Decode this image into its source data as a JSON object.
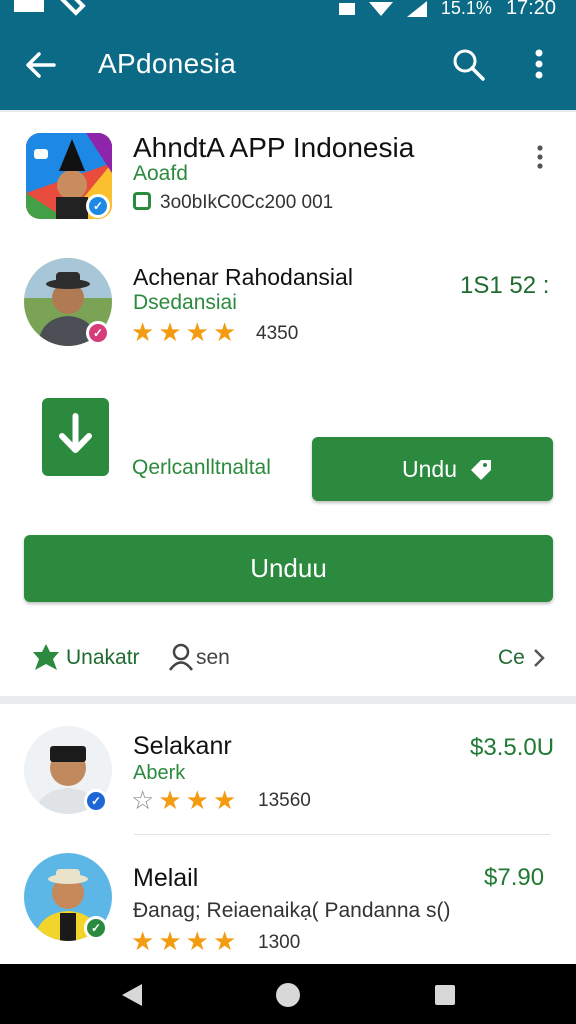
{
  "appbar": {
    "title": "APdonesia"
  },
  "app_header": {
    "name": "AhndtA APP Indonesia",
    "subtitle": "Aoafd",
    "code": "3o0bIkC0Cc200 001"
  },
  "reviewer": {
    "name": "Achenar Rahodansial",
    "subtitle": "Dsedansiai",
    "rating_count": "4350",
    "value": "1S1 52 :"
  },
  "install": {
    "label": "Qerlcanlltnaltal",
    "small_button": "Undu",
    "big_button": "Unduu"
  },
  "footer": {
    "left": "Unakatr",
    "middle": "sen",
    "right": "Ce"
  },
  "list": [
    {
      "name": "Selakanr",
      "subtitle": "Aberk",
      "rating_count": "13560",
      "price": "$3.5.0U"
    },
    {
      "name": "Melail",
      "subtitle": "Đanag; Reiaenaikạ( Pandanna s()",
      "rating_count": "1300",
      "price": "$7.90"
    }
  ],
  "colors": {
    "appbar": "#0b6b86",
    "accent": "#2b8a3e",
    "star": "#f39c12"
  }
}
